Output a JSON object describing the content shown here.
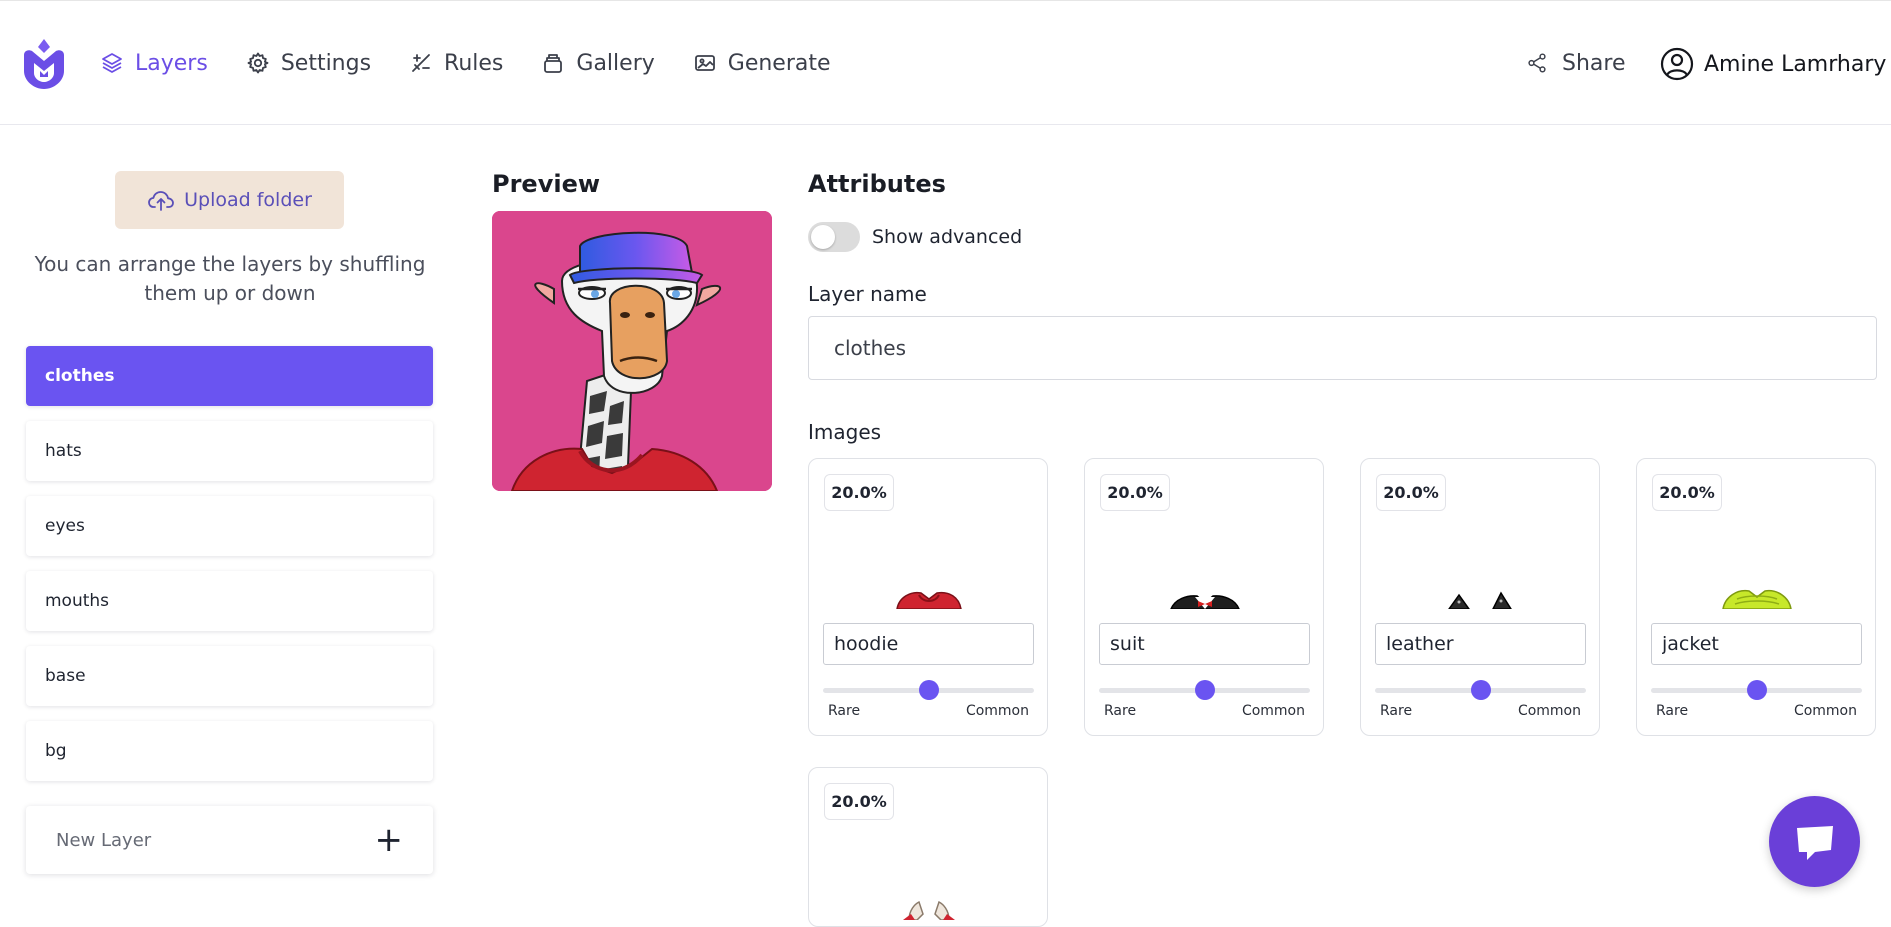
{
  "header": {
    "nav": [
      {
        "label": "Layers",
        "icon": "layers-icon",
        "active": true
      },
      {
        "label": "Settings",
        "icon": "gear-icon",
        "active": false
      },
      {
        "label": "Rules",
        "icon": "rules-icon",
        "active": false
      },
      {
        "label": "Gallery",
        "icon": "gallery-icon",
        "active": false
      },
      {
        "label": "Generate",
        "icon": "image-icon",
        "active": false
      }
    ],
    "share_label": "Share",
    "user_name": "Amine Lamrhary"
  },
  "sidebar": {
    "upload_label": "Upload folder",
    "hint": "You can arrange the layers by shuffling them up or down",
    "layers": [
      {
        "label": "clothes",
        "active": true
      },
      {
        "label": "hats",
        "active": false
      },
      {
        "label": "eyes",
        "active": false
      },
      {
        "label": "mouths",
        "active": false
      },
      {
        "label": "base",
        "active": false
      },
      {
        "label": "bg",
        "active": false
      }
    ],
    "new_layer_placeholder": "New Layer"
  },
  "preview": {
    "title": "Preview"
  },
  "attributes": {
    "title": "Attributes",
    "show_advanced_label": "Show advanced",
    "show_advanced_on": false,
    "layer_name_label": "Layer name",
    "layer_name_value": "clothes",
    "images_label": "Images",
    "images": [
      {
        "percent": "20.0%",
        "name": "hoodie",
        "slider": 0.5,
        "rare_label": "Rare",
        "common_label": "Common"
      },
      {
        "percent": "20.0%",
        "name": "suit",
        "slider": 0.5,
        "rare_label": "Rare",
        "common_label": "Common"
      },
      {
        "percent": "20.0%",
        "name": "leather",
        "slider": 0.5,
        "rare_label": "Rare",
        "common_label": "Common"
      },
      {
        "percent": "20.0%",
        "name": "jacket",
        "slider": 0.5,
        "rare_label": "Rare",
        "common_label": "Common"
      },
      {
        "percent": "20.0%"
      }
    ]
  },
  "colors": {
    "accent": "#6a54f1",
    "upload_bg": "#f1e4d8",
    "preview_bg": "#da468d",
    "chat_button": "#6a3fd8"
  }
}
